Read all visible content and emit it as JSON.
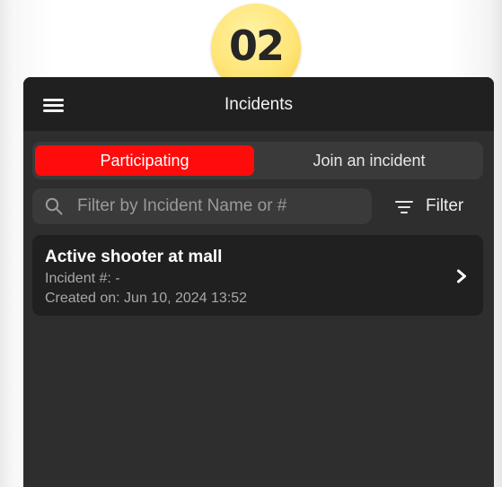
{
  "step_badge": {
    "label": "02"
  },
  "header": {
    "title": "Incidents",
    "menu_icon": "hamburger-menu-icon"
  },
  "tabs": [
    {
      "label": "Participating",
      "selected": true
    },
    {
      "label": "Join an incident",
      "selected": false
    }
  ],
  "search": {
    "placeholder": "Filter by Incident Name or #",
    "value": "",
    "icon": "search-icon"
  },
  "filter": {
    "label": "Filter",
    "icon": "filter-lines-icon"
  },
  "incidents": [
    {
      "name": "Active shooter at mall",
      "number_line": "Incident #: -",
      "created_line": "Created on: Jun 10, 2024 13:52",
      "icon": "chevron-right-icon"
    }
  ],
  "colors": {
    "accent": "#ff0b0b",
    "screen_background": "#2e2e2e",
    "nav_background": "#202020",
    "card_background": "#202020",
    "badge": "#ffe577"
  }
}
